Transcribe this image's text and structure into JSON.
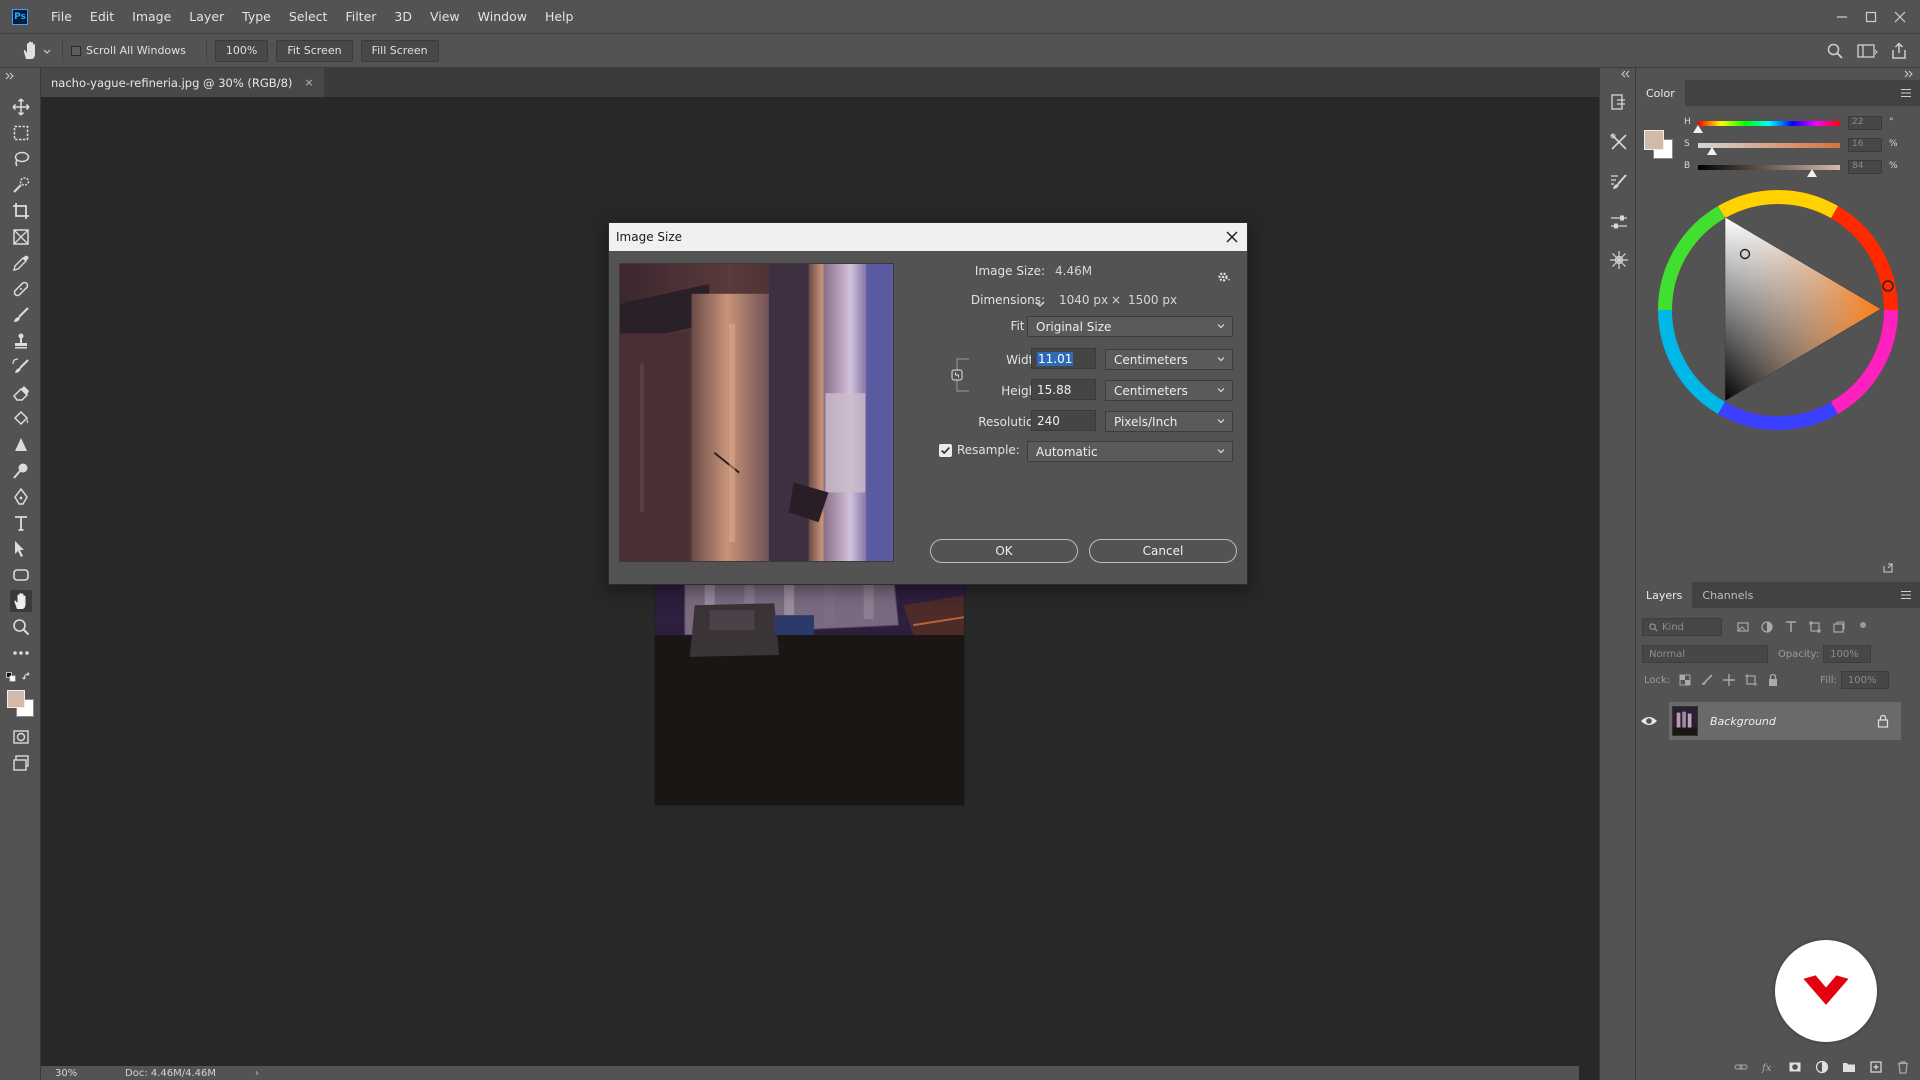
{
  "app": {
    "logo": "Ps",
    "menu": [
      "File",
      "Edit",
      "Image",
      "Layer",
      "Type",
      "Select",
      "Filter",
      "3D",
      "View",
      "Window",
      "Help"
    ]
  },
  "options_bar": {
    "scroll_all_windows": "Scroll All Windows",
    "zoom_100": "100%",
    "fit_screen": "Fit Screen",
    "fill_screen": "Fill Screen"
  },
  "document": {
    "tab_title": "nacho-yague-refineria.jpg @ 30% (RGB/8)",
    "tab_close": "×"
  },
  "status": {
    "zoom": "30%",
    "doc": "Doc: 4.46M/4.46M",
    "arrow": "›"
  },
  "dialog": {
    "title": "Image Size",
    "image_size_label": "Image Size:",
    "image_size_value": "4.46M",
    "dimensions_label": "Dimensions:",
    "dim_width": "1040 px",
    "dim_times": "×",
    "dim_height": "1500 px",
    "fit_to_label": "Fit To:",
    "fit_to_value": "Original Size",
    "width_label": "Width:",
    "width_value": "11.01",
    "width_unit": "Centimeters",
    "height_label": "Height:",
    "height_value": "15.88",
    "height_unit": "Centimeters",
    "resolution_label": "Resolution:",
    "resolution_value": "240",
    "resolution_unit": "Pixels/Inch",
    "resample_label": "Resample:",
    "resample_checked": true,
    "resample_value": "Automatic",
    "ok": "OK",
    "cancel": "Cancel"
  },
  "color_panel": {
    "tab": "Color",
    "h_label": "H",
    "s_label": "S",
    "b_label": "B",
    "h_value": "22",
    "s_value": "16",
    "b_value": "84",
    "h_unit": "°",
    "s_unit": "%",
    "b_unit": "%",
    "foreground": "#d3b9a8",
    "background": "#ffffff"
  },
  "layers_panel": {
    "tabs": [
      "Layers",
      "Channels"
    ],
    "filter_placeholder": "Kind",
    "blend_mode": "Normal",
    "opacity_label": "Opacity:",
    "opacity_value": "100%",
    "lock_label": "Lock:",
    "fill_label": "Fill:",
    "fill_value": "100%",
    "layers": [
      {
        "name": "Background",
        "visible": true,
        "locked": true
      }
    ]
  },
  "colors": {
    "chrome": "#535353",
    "canvas": "#282828",
    "accent_blue": "#2d6bb8",
    "brand_red": "#e3000f"
  }
}
